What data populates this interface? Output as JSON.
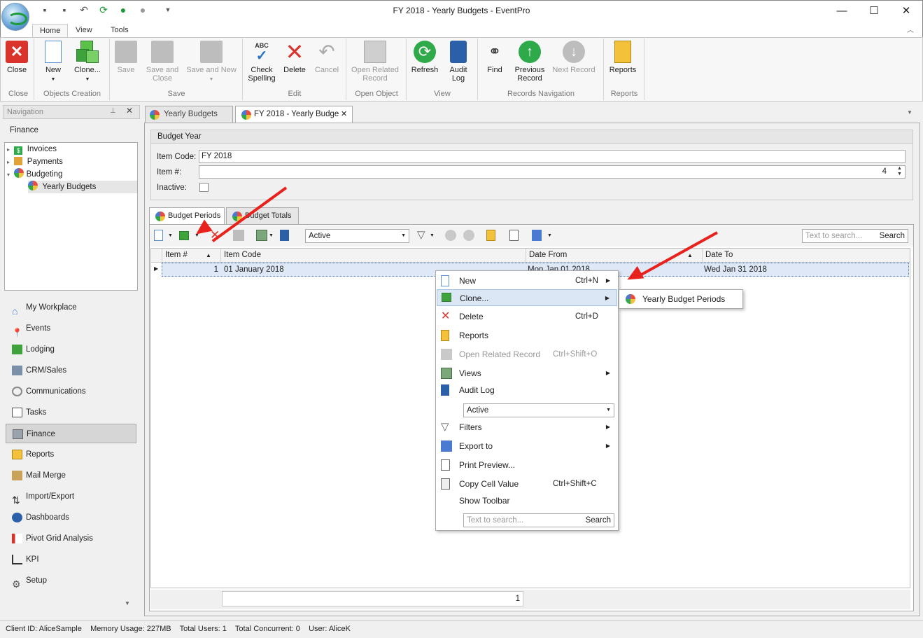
{
  "window": {
    "title": "FY 2018 - Yearly Budgets - EventPro",
    "minimize": "—",
    "maximize": "☐",
    "close": "✕"
  },
  "ribbon_tabs": [
    "Home",
    "View",
    "Tools"
  ],
  "ribbon": {
    "close": "Close",
    "new": "New",
    "clone": "Clone...",
    "save": "Save",
    "save_close_1": "Save and",
    "save_close_2": "Close",
    "save_new": "Save and New",
    "check_1": "Check",
    "check_2": "Spelling",
    "check_abc": "ABC",
    "delete": "Delete",
    "cancel": "Cancel",
    "open_related_1": "Open Related",
    "open_related_2": "Record",
    "refresh": "Refresh",
    "audit_1": "Audit",
    "audit_2": "Log",
    "find": "Find",
    "prev_1": "Previous",
    "prev_2": "Record",
    "next": "Next Record",
    "reports": "Reports",
    "groups": {
      "close": "Close",
      "objects": "Objects Creation",
      "save": "Save",
      "edit": "Edit",
      "open": "Open Object",
      "view": "View",
      "records_nav": "Records Navigation",
      "reports": "Reports"
    }
  },
  "nav": {
    "header": "Navigation",
    "section": "Finance",
    "tree": [
      "Invoices",
      "Payments",
      "Budgeting",
      "Yearly Budgets"
    ],
    "buttons": [
      "My Workplace",
      "Events",
      "Lodging",
      "CRM/Sales",
      "Communications",
      "Tasks",
      "Finance",
      "Reports",
      "Mail Merge",
      "Import/Export",
      "Dashboards",
      "Pivot Grid Analysis",
      "KPI",
      "Setup"
    ]
  },
  "doc_tabs": [
    "Yearly Budgets",
    "FY 2018 - Yearly Budge"
  ],
  "form": {
    "group_title": "Budget Year",
    "item_code_label": "Item Code:",
    "item_code_value": "FY 2018",
    "item_no_label": "Item #:",
    "item_no_value": "4",
    "inactive_label": "Inactive:"
  },
  "inner_tabs": [
    "Budget Periods",
    "Budget Totals"
  ],
  "grid_toolbar": {
    "filter_value": "Active",
    "search_placeholder": "Text to search...",
    "search_button": "Search"
  },
  "grid": {
    "columns": [
      "Item #",
      "Item Code",
      "Date From",
      "Date To"
    ],
    "rows": [
      {
        "item_no": "1",
        "item_code": "01 January 2018",
        "date_from": "Mon Jan 01 2018",
        "date_to": "Wed Jan 31 2018"
      }
    ],
    "footer_count": "1"
  },
  "context_menu": {
    "new": "New",
    "new_sc": "Ctrl+N",
    "clone": "Clone...",
    "delete": "Delete",
    "delete_sc": "Ctrl+D",
    "reports": "Reports",
    "open_related": "Open Related Record",
    "open_related_sc": "Ctrl+Shift+O",
    "views": "Views",
    "audit_log": "Audit Log",
    "filter_value": "Active",
    "filters": "Filters",
    "export": "Export to",
    "print_preview": "Print Preview...",
    "copy_cell": "Copy Cell Value",
    "copy_cell_sc": "Ctrl+Shift+C",
    "show_toolbar": "Show Toolbar",
    "search_placeholder": "Text to search...",
    "search_button": "Search"
  },
  "submenu": {
    "yearly_budget_periods": "Yearly Budget Periods"
  },
  "status": {
    "client": "Client ID: AliceSample",
    "memory": "Memory Usage: 227MB",
    "users": "Total Users: 1",
    "concurrent": "Total Concurrent: 0",
    "user": "User: AliceK"
  },
  "colors": {
    "accent": "#2b579a",
    "highlight": "#dce7f5",
    "annotation_arrow": "#e8211c"
  }
}
